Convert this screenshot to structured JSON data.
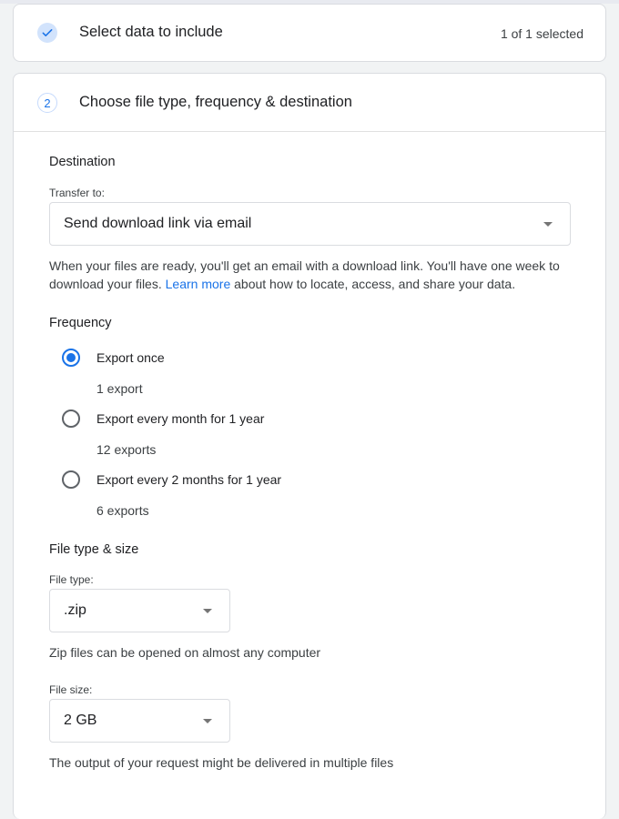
{
  "step1": {
    "title": "Select data to include",
    "selected_count": "1 of 1 selected"
  },
  "step2": {
    "number": "2",
    "title": "Choose file type, frequency & destination"
  },
  "destination": {
    "heading": "Destination",
    "transfer_label": "Transfer to:",
    "transfer_value": "Send download link via email",
    "help_before_link": "When your files are ready, you'll get an email with a download link. You'll have one week to download your files. ",
    "help_link": "Learn more",
    "help_after_link": " about how to locate, access, and share your data."
  },
  "frequency": {
    "heading": "Frequency",
    "options": [
      {
        "label": "Export once",
        "sub": "1 export",
        "checked": true
      },
      {
        "label": "Export every month for 1 year",
        "sub": "12 exports",
        "checked": false
      },
      {
        "label": "Export every 2 months for 1 year",
        "sub": "6 exports",
        "checked": false
      }
    ]
  },
  "file": {
    "heading": "File type & size",
    "type_label": "File type:",
    "type_value": ".zip",
    "type_help": "Zip files can be opened on almost any computer",
    "size_label": "File size:",
    "size_value": "2 GB",
    "size_help": "The output of your request might be delivered in multiple files"
  },
  "colors": {
    "accent": "#1a73e8",
    "check_bg": "#d2e3fc",
    "border": "#dadce0"
  },
  "icons": {
    "step1": "check-icon",
    "select_caret": "chevron-down-icon"
  }
}
